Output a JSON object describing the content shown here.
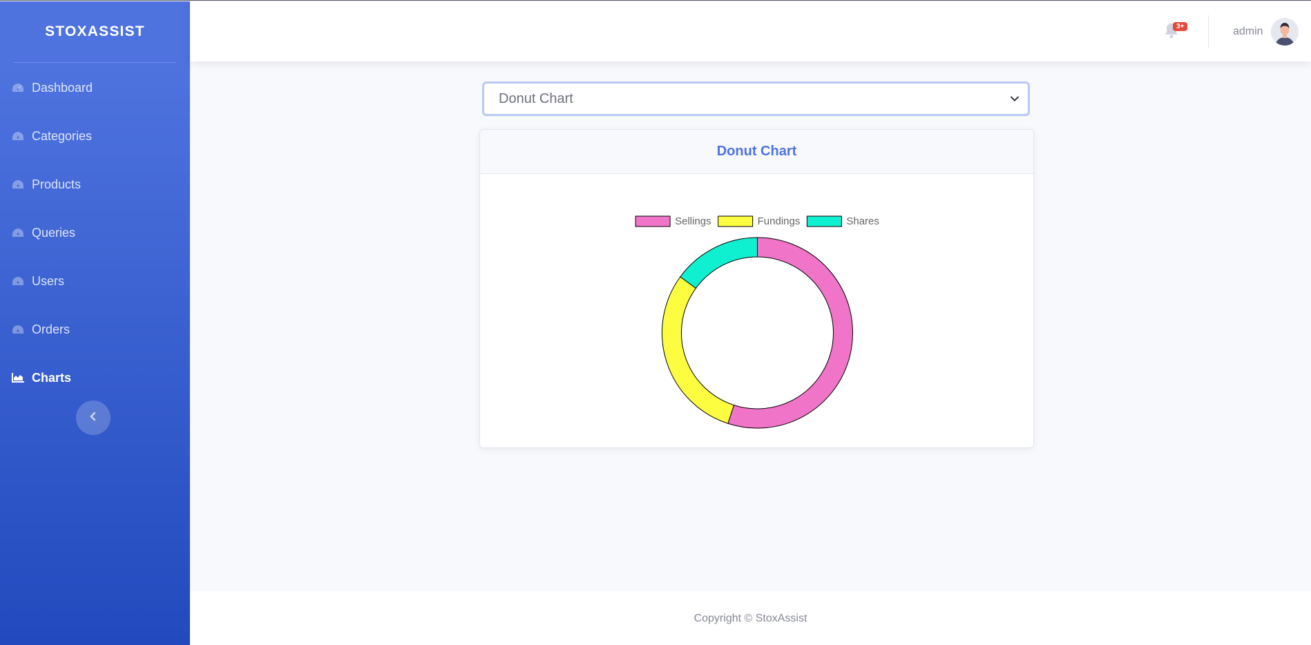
{
  "brand": "STOXASSIST",
  "sidebar": {
    "items": [
      {
        "label": "Dashboard",
        "icon": "tachometer-icon",
        "active": false
      },
      {
        "label": "Categories",
        "icon": "tachometer-icon",
        "active": false
      },
      {
        "label": "Products",
        "icon": "tachometer-icon",
        "active": false
      },
      {
        "label": "Queries",
        "icon": "tachometer-icon",
        "active": false
      },
      {
        "label": "Users",
        "icon": "tachometer-icon",
        "active": false
      },
      {
        "label": "Orders",
        "icon": "tachometer-icon",
        "active": false
      },
      {
        "label": "Charts",
        "icon": "area-chart-icon",
        "active": true
      }
    ],
    "toggle_icon": "chevron-left-icon"
  },
  "topbar": {
    "notification_badge": "3+",
    "user_name": "admin"
  },
  "chart_select": {
    "selected": "Donut Chart"
  },
  "card": {
    "title": "Donut Chart"
  },
  "chart_data": {
    "type": "pie",
    "donut": true,
    "legend_position": "top",
    "categories": [
      "Sellings",
      "Fundings",
      "Shares"
    ],
    "values": [
      55,
      30,
      15
    ],
    "colors": [
      "#f075c8",
      "#fcfc40",
      "#0ff0d0"
    ]
  },
  "footer": {
    "text": "Copyright © StoxAssist"
  },
  "colors": {
    "primary": "#4e73df",
    "sidebar_gradient_end": "#224abe",
    "danger": "#e74a3b"
  }
}
